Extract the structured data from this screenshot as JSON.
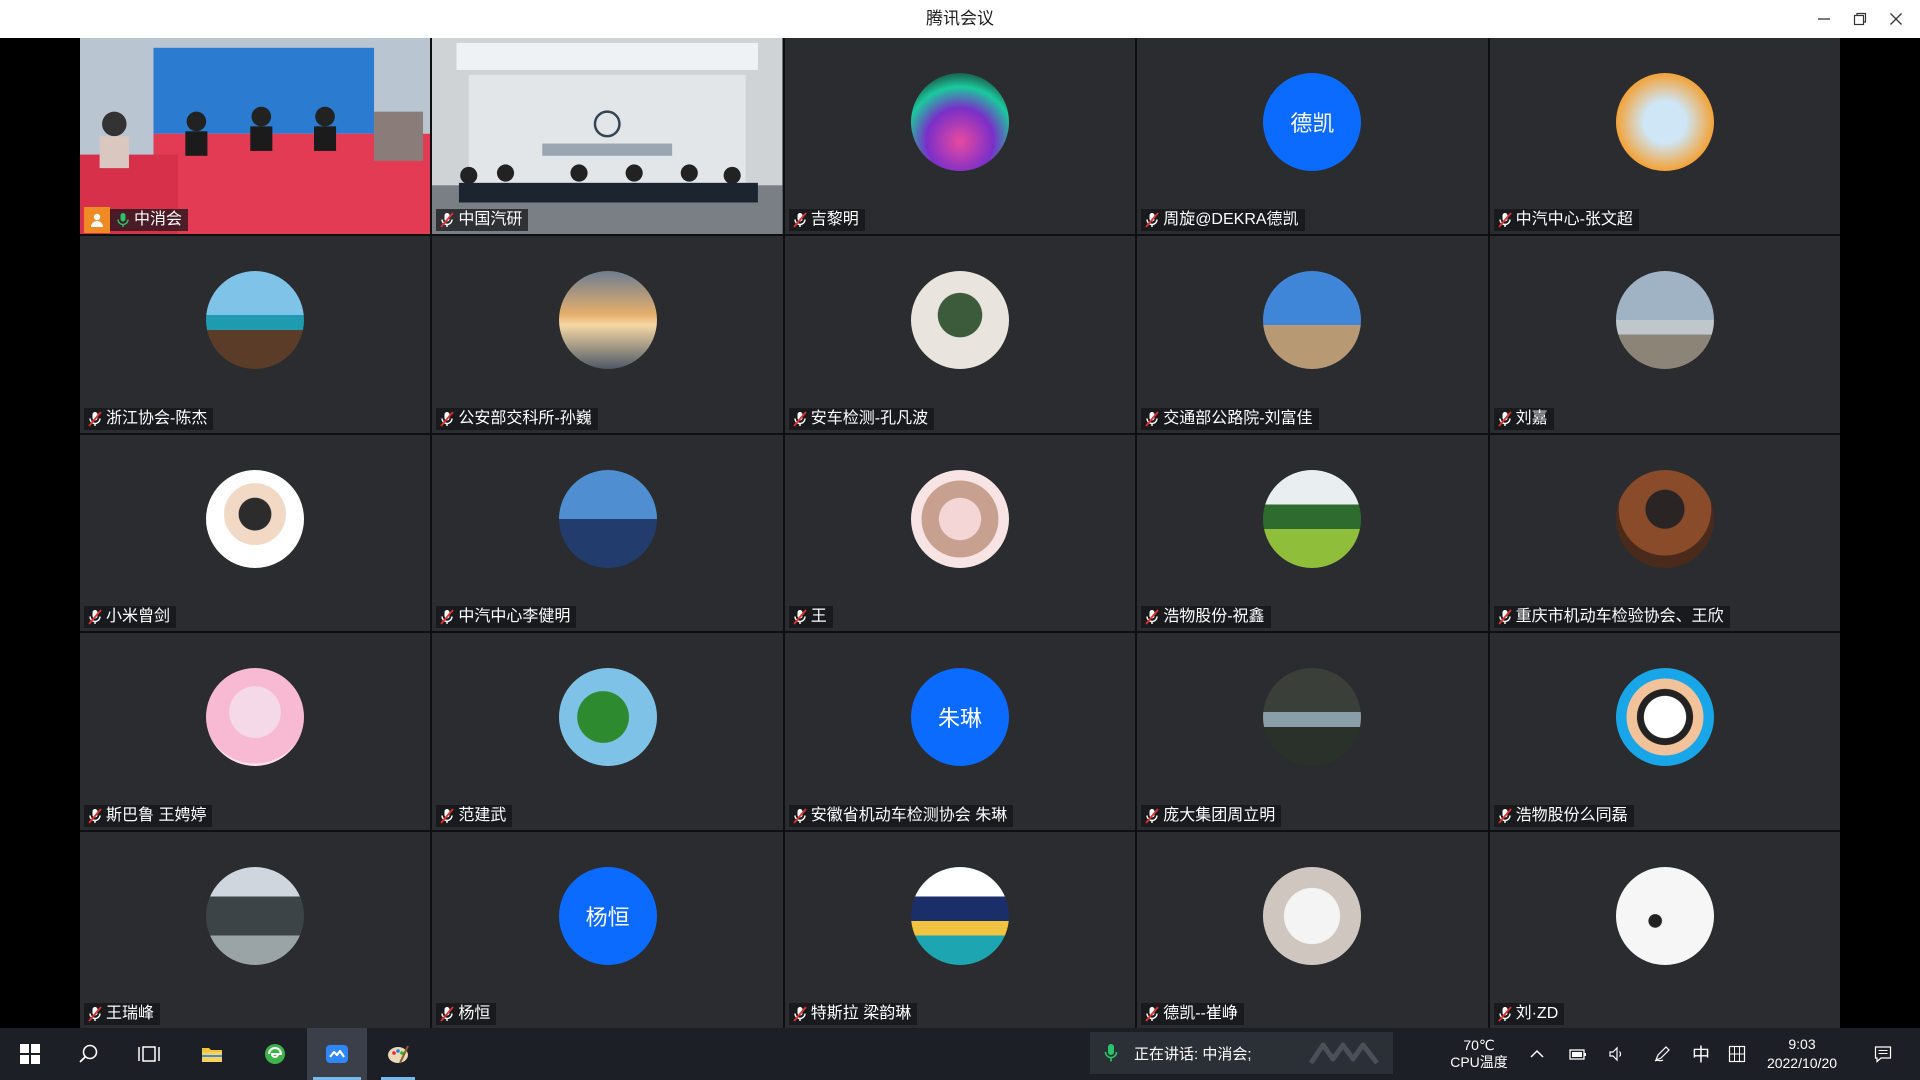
{
  "window": {
    "title": "腾讯会议"
  },
  "participants": [
    {
      "name": "中消会",
      "avatar": "video-room-1",
      "host": true,
      "mic": "active"
    },
    {
      "name": "中国汽研",
      "avatar": "video-room-2",
      "mic": "muted"
    },
    {
      "name": "吉黎明",
      "avatar": "image",
      "mic": "muted"
    },
    {
      "name": "周旋@DEKRA德凯",
      "avatar_text": "德凯",
      "mic": "muted"
    },
    {
      "name": "中汽中心-张文超",
      "avatar": "image",
      "mic": "muted"
    },
    {
      "name": "浙江协会-陈杰",
      "avatar": "image",
      "mic": "muted"
    },
    {
      "name": "公安部交科所-孙巍",
      "avatar": "image",
      "mic": "muted"
    },
    {
      "name": "安车检测-孔凡波",
      "avatar": "image",
      "mic": "muted"
    },
    {
      "name": "交通部公路院-刘富佳",
      "avatar": "image",
      "mic": "muted"
    },
    {
      "name": "刘嘉",
      "avatar": "image",
      "mic": "muted"
    },
    {
      "name": "小米曾剑",
      "avatar": "image",
      "mic": "muted"
    },
    {
      "name": "中汽中心李健明",
      "avatar": "image",
      "mic": "muted"
    },
    {
      "name": "王",
      "avatar": "image",
      "mic": "muted"
    },
    {
      "name": "浩物股份-祝鑫",
      "avatar": "image",
      "mic": "muted"
    },
    {
      "name": "重庆市机动车检验协会、王欣",
      "avatar": "image",
      "mic": "muted"
    },
    {
      "name": "斯巴鲁 王娉婷",
      "avatar": "image",
      "mic": "muted"
    },
    {
      "name": "范建武",
      "avatar": "image",
      "mic": "muted"
    },
    {
      "name": "安徽省机动车检测协会 朱琳",
      "avatar_text": "朱琳",
      "mic": "muted"
    },
    {
      "name": "庞大集团周立明",
      "avatar": "image",
      "mic": "muted"
    },
    {
      "name": "浩物股份么同磊",
      "avatar": "image",
      "mic": "muted"
    },
    {
      "name": "王瑞峰",
      "avatar": "image",
      "mic": "muted"
    },
    {
      "name": "杨恒",
      "avatar_text": "杨恒",
      "mic": "muted"
    },
    {
      "name": "特斯拉 梁韵琳",
      "avatar": "image",
      "mic": "muted"
    },
    {
      "name": "德凯--崔峥",
      "avatar": "image",
      "mic": "muted"
    },
    {
      "name": "刘·ZD",
      "avatar": "image",
      "mic": "muted"
    }
  ],
  "taskbar": {
    "speaking_text": "正在讲话: 中消会;",
    "cpu_temp": "70℃",
    "cpu_label": "CPU温度",
    "ime": "中",
    "time": "9:03",
    "date": "2022/10/20"
  },
  "colors": {
    "avatar_blue": "#0b6bff",
    "active_speaker": "#29c46a",
    "host_badge": "#f08a24",
    "tile_bg": "#2a2c2f"
  }
}
